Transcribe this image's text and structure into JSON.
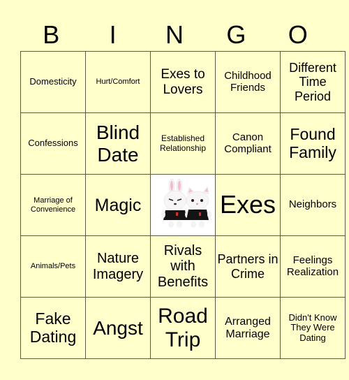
{
  "header": {
    "letters": [
      "B",
      "I",
      "N",
      "G",
      "O"
    ]
  },
  "board": {
    "rows": [
      [
        "Domesticity",
        "Hurt/Comfort",
        "Exes to Lovers",
        "Childhood Friends",
        "Different Time Period"
      ],
      [
        "Confessions",
        "Blind Date",
        "Established Relationship",
        "Canon Compliant",
        "Found Family"
      ],
      [
        "Marriage of Convenience",
        "Magic",
        "",
        "Exes",
        "Neighbors"
      ],
      [
        "Animals/Pets",
        "Nature Imagery",
        "Rivals with Benefits",
        "Partners in Crime",
        "Feelings Realization"
      ],
      [
        "Fake Dating",
        "Angst",
        "Road Trip",
        "Arranged Marriage",
        "Didn't Know They Were Dating"
      ]
    ],
    "free_space": {
      "icon": "plush-bunny-and-cat-icon",
      "description": "Two white plush toys (bunny and cat) in black shirts"
    }
  },
  "colors": {
    "background": "#ffffcc",
    "cell": "#ffffcc",
    "free_cell": "#ffffff",
    "border": "#5a5a4a",
    "text": "#000000"
  }
}
